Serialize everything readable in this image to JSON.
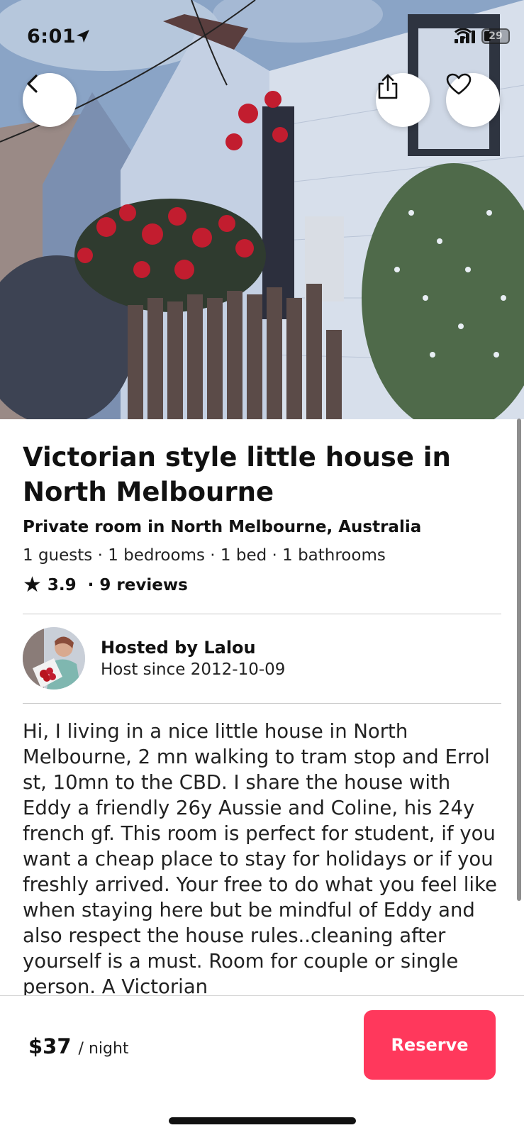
{
  "status_bar": {
    "time": "6:01",
    "battery": "29"
  },
  "hero": {
    "photo": "victorian-house-photo"
  },
  "actions": {
    "back_icon": "chevron-left-icon",
    "share_icon": "share-icon",
    "favorite_icon": "heart-icon"
  },
  "listing": {
    "title": "Victorian style little house in North Melbourne",
    "room_type": "Private room in North Melbourne, Australia",
    "specs": "1 guests · 1 bedrooms · 1 bed · 1 bathrooms",
    "rating": "3.9",
    "reviews": "· 9 reviews"
  },
  "host": {
    "name": "Hosted by Lalou",
    "since": "Host since 2012-10-09"
  },
  "description": "Hi, I living in a nice little house in North Melbourne, 2 mn walking to tram stop and Errol st, 10mn to the CBD. I share the house with Eddy a friendly 26y Aussie and Coline, his 24y french gf. This room is perfect for student, if you want a cheap place to stay for holidays or if you freshly arrived.  Your free to do what you feel like when staying here but be mindful of Eddy and also respect the house rules..cleaning after yourself is a must. Room for couple or single person. A Victorian",
  "booking": {
    "price": "$37",
    "unit": "/ night",
    "reserve_label": "Reserve"
  },
  "colors": {
    "brand": "#ff385c"
  }
}
